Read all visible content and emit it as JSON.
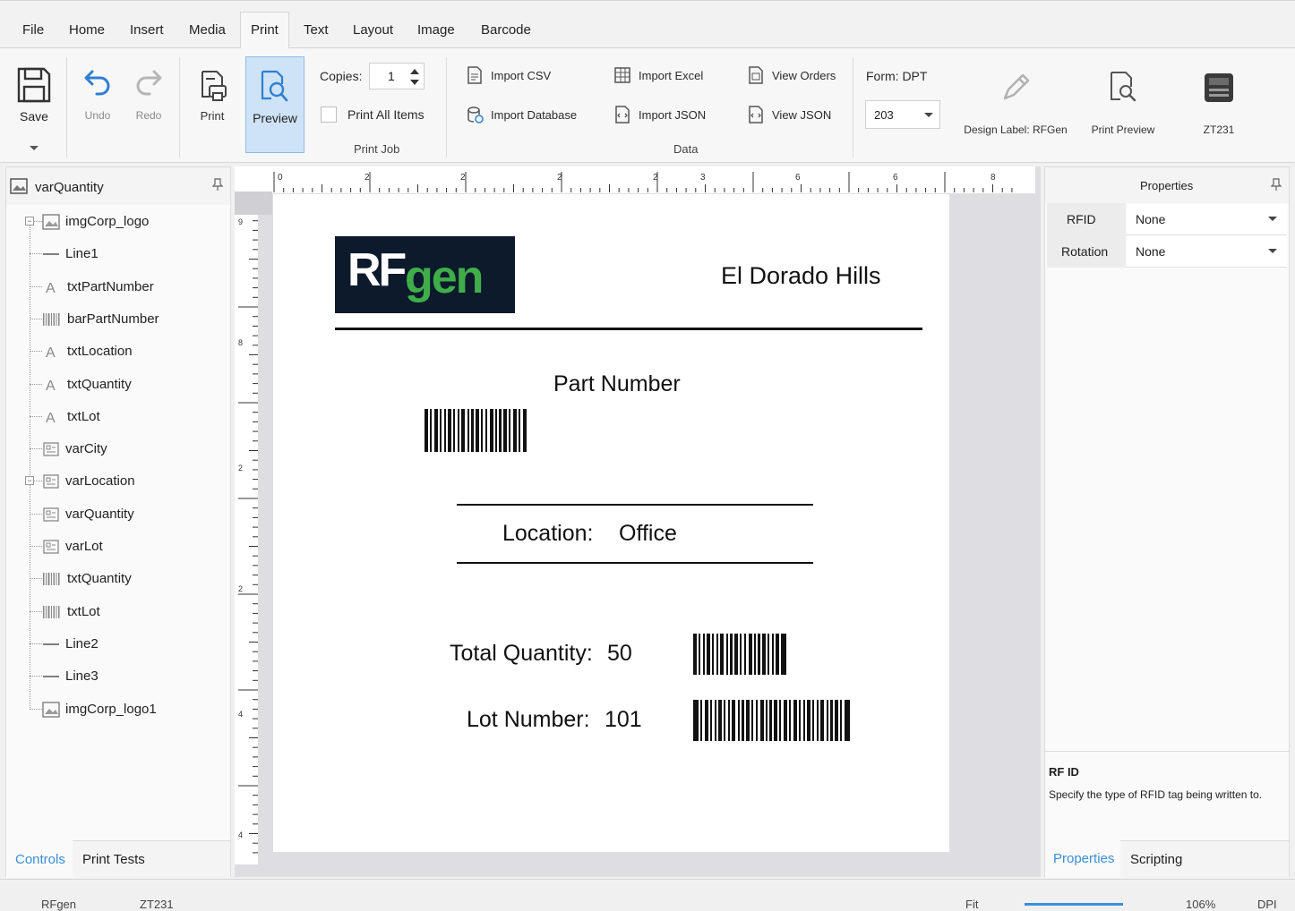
{
  "menu": {
    "items": [
      "File",
      "Home",
      "Insert",
      "Media",
      "Print",
      "Text",
      "Layout",
      "Image",
      "Barcode"
    ],
    "active": "Print"
  },
  "ribbon": {
    "save": "Save",
    "undo": "Undo",
    "redo": "Redo",
    "print": "Print",
    "preview": "Preview",
    "copies_label": "Copies:",
    "copies_value": "1",
    "print_all_items": "Print All Items",
    "print_job_group": "Print Job",
    "import_csv": "Import CSV",
    "import_database": "Import Database",
    "import_excel": "Import Excel",
    "import_json": "Import JSON",
    "view_orders": "View Orders",
    "view_json": "View JSON",
    "data_group": "Data",
    "form_label": "Form: DPT",
    "dpi_value": "203",
    "design_label": "Design Label: RFGen",
    "print_preview": "Print Preview",
    "printer": "ZT231"
  },
  "left_panel": {
    "header": "varQuantity",
    "items": [
      {
        "label": "imgCorp_logo",
        "icon": "image-icon"
      },
      {
        "label": "Line1",
        "icon": "line-icon"
      },
      {
        "label": "txtPartNumber",
        "icon": "text-icon"
      },
      {
        "label": "barPartNumber",
        "icon": "barcode-icon"
      },
      {
        "label": "txtLocation",
        "icon": "text-icon"
      },
      {
        "label": "txtQuantity",
        "icon": "text-icon"
      },
      {
        "label": "txtLot",
        "icon": "text-icon"
      },
      {
        "label": "varCity",
        "icon": "variable-icon"
      },
      {
        "label": "varLocation",
        "icon": "variable-icon"
      },
      {
        "label": "varQuantity",
        "icon": "variable-icon"
      },
      {
        "label": "varLot",
        "icon": "variable-icon"
      },
      {
        "label": "txtQuantity",
        "icon": "barcode-icon"
      },
      {
        "label": "txtLot",
        "icon": "barcode-icon"
      },
      {
        "label": "Line2",
        "icon": "line-icon"
      },
      {
        "label": "Line3",
        "icon": "line-icon"
      },
      {
        "label": "imgCorp_logo1",
        "icon": "image-icon"
      }
    ],
    "tab_controls": "Controls",
    "tab_print_tests": "Print Tests"
  },
  "label": {
    "logo_rf": "RF",
    "logo_gen": "gen",
    "city": "El Dorado Hills",
    "part_number_title": "Part Number",
    "location_label": "Location:",
    "location_value": "Office",
    "quantity_label": "Total Quantity:",
    "quantity_value": "50",
    "lot_label": "Lot Number:",
    "lot_value": "101"
  },
  "ruler": {
    "marks": [
      "0",
      "2",
      "2",
      "2",
      "2",
      "3",
      "6",
      "6",
      "8"
    ],
    "vmarks": [
      "9",
      "8",
      "2",
      "2",
      "4",
      "4"
    ]
  },
  "right_panel": {
    "title": "Properties",
    "props": [
      {
        "name": "RFID",
        "value": "None"
      },
      {
        "name": "Rotation",
        "value": "None"
      }
    ],
    "desc_title": "RF ID",
    "desc_text": "Specify the type of RFID tag being written to.",
    "tab_properties": "Properties",
    "tab_scripting": "Scripting"
  },
  "status": {
    "left1": "RFgen",
    "left2": "ZT231",
    "fit": "Fit",
    "zoom": "106%",
    "dpi": "DPI"
  },
  "colors": {
    "accent": "#3b8fd9",
    "preview_bg": "#cfe3f7",
    "logo_bg": "#0c1a2c",
    "logo_green": "#3fae49"
  }
}
